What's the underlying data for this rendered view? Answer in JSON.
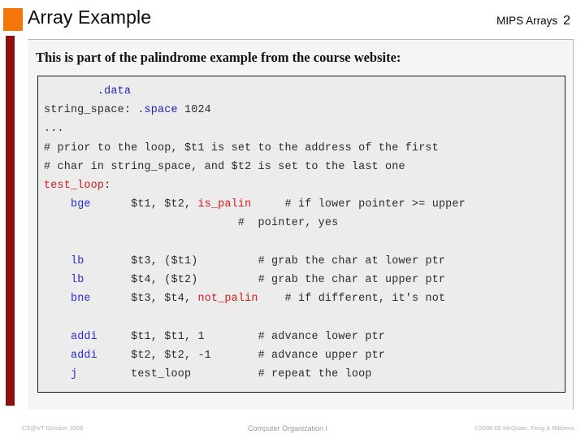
{
  "theme": {
    "accent_orange": "#f4760a",
    "rail_maroon": "#8c1010",
    "panel_bg": "#f5f5f5",
    "code_bg": "#ececec",
    "directive_blue": "#1f1fb4",
    "instruction_blue": "#2a2ad0",
    "label_red": "#d61a1a",
    "code_text": "#2b2b2b",
    "footer_gray": "#b2b2b2"
  },
  "header": {
    "title": "Array Example",
    "course_label": "MIPS Arrays",
    "page_number": "2"
  },
  "body": {
    "lede": "This is part of the palindrome example from the course website:"
  },
  "code": {
    "lines": [
      [
        {
          "t": "        ",
          "c": "plain"
        },
        {
          "t": ".data",
          "c": "dir"
        }
      ],
      [
        {
          "t": "string_space: ",
          "c": "plain"
        },
        {
          "t": ".space",
          "c": "dir"
        },
        {
          "t": " 1024",
          "c": "plain"
        }
      ],
      [
        {
          "t": "...",
          "c": "plain"
        }
      ],
      [
        {
          "t": "# prior to the loop, $t1 is set to the address of the first",
          "c": "plain"
        }
      ],
      [
        {
          "t": "# char in string_space, and $t2 is set to the last one",
          "c": "plain"
        }
      ],
      [
        {
          "t": "test_loop",
          "c": "lbl"
        },
        {
          "t": ":",
          "c": "plain"
        }
      ],
      [
        {
          "t": "    ",
          "c": "plain"
        },
        {
          "t": "bge",
          "c": "ins"
        },
        {
          "t": "      $t1, $t2, ",
          "c": "plain"
        },
        {
          "t": "is_palin",
          "c": "lbl"
        },
        {
          "t": "     # if lower pointer >= upper",
          "c": "plain"
        }
      ],
      [
        {
          "t": "                             #  pointer, yes",
          "c": "plain"
        }
      ],
      [
        {
          "t": "",
          "c": "plain"
        }
      ],
      [
        {
          "t": "    ",
          "c": "plain"
        },
        {
          "t": "lb",
          "c": "ins"
        },
        {
          "t": "       $t3, ($t1)         # grab the char at lower ptr",
          "c": "plain"
        }
      ],
      [
        {
          "t": "    ",
          "c": "plain"
        },
        {
          "t": "lb",
          "c": "ins"
        },
        {
          "t": "       $t4, ($t2)         # grab the char at upper ptr",
          "c": "plain"
        }
      ],
      [
        {
          "t": "    ",
          "c": "plain"
        },
        {
          "t": "bne",
          "c": "ins"
        },
        {
          "t": "      $t3, $t4, ",
          "c": "plain"
        },
        {
          "t": "not_palin",
          "c": "lbl"
        },
        {
          "t": "    # if different, it's not",
          "c": "plain"
        }
      ],
      [
        {
          "t": "",
          "c": "plain"
        }
      ],
      [
        {
          "t": "    ",
          "c": "plain"
        },
        {
          "t": "addi",
          "c": "ins"
        },
        {
          "t": "     $t1, $t1, 1        # advance lower ptr",
          "c": "plain"
        }
      ],
      [
        {
          "t": "    ",
          "c": "plain"
        },
        {
          "t": "addi",
          "c": "ins"
        },
        {
          "t": "     $t2, $t2, -1       # advance upper ptr",
          "c": "plain"
        }
      ],
      [
        {
          "t": "    ",
          "c": "plain"
        },
        {
          "t": "j",
          "c": "ins"
        },
        {
          "t": "        test_loop          # repeat the loop",
          "c": "plain"
        }
      ],
      [
        {
          "t": "...",
          "c": "plain"
        }
      ]
    ]
  },
  "footer": {
    "left": "CS@VT October 2009",
    "center": "Computer Organization I",
    "right": "©2006-09  McQuain, Feng & Ribbens"
  }
}
